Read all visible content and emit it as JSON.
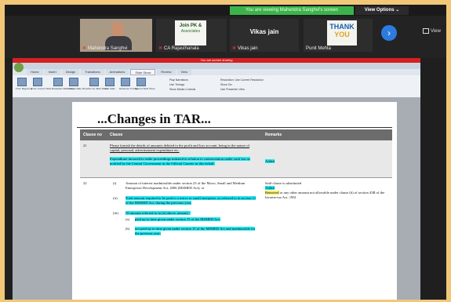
{
  "banner": {
    "text": "You are viewing Mahendra Sanghvi's screen"
  },
  "view_options": {
    "label": "View Options",
    "chevron": "chevron-down-icon"
  },
  "participants": [
    {
      "name": "Mahendra Sanghvi"
    },
    {
      "name": "CA Rajasthanala"
    },
    {
      "name": "Vikas jain",
      "display": "Vikas jain"
    },
    {
      "name": "Punit Mehta"
    }
  ],
  "logo": {
    "line1": "Join PK &",
    "line2": "Associates"
  },
  "thank_you": {
    "line1": "THANK",
    "line2": "YOU"
  },
  "view_label": "View",
  "app": {
    "redbar": "You are screen sharing",
    "tabs": [
      "Home",
      "Insert",
      "Design",
      "Transitions",
      "Animations",
      "Slide Show",
      "Review",
      "View"
    ],
    "ribbon": {
      "buttons": [
        "From Beginning",
        "From Current Slide",
        "Broadcast Slide Show",
        "Custom Slide Show",
        "Set Up Slide Show",
        "Hide Slide",
        "Rehearse Timings",
        "Record Slide Show"
      ],
      "options": [
        "Play Narrations",
        "Use Timings",
        "Show Media Controls"
      ],
      "monitor": [
        "Resolution: Use Current Resolution",
        "Show On:",
        "Use Presenter View"
      ]
    }
  },
  "slide": {
    "title": "...Changes in TAR...",
    "columns": [
      "Clause no",
      "Clause",
      "Remarks"
    ],
    "rows": [
      {
        "no": "21",
        "clause_plain": "Please furnish the details of amounts debited to the profit and loss account, being in the nature of capital, personal, advertisement expenditure etc.",
        "clause_added": "Expenditure incurred to settle proceedings initiated in relation to contravention under such law as notified by the Central Government in the Official Gazette in this behalf.",
        "remark": "Added"
      },
      {
        "no": "22",
        "items": [
          {
            "label": "(i)",
            "text": "Amount of interest inadmissible under section 23 of the Micro, Small and Medium Enterprises Development Act, 2006 (MSMED Act); or"
          },
          {
            "label": "(ii)",
            "text": "Total amount required to be paid to a micro or small enterprise, as referred to in section 15 of the MSMED Act, during the previous year;"
          },
          {
            "label": "(iii)",
            "text": "Of amount referred to in (ii) above, amount -"
          },
          {
            "label": "(a)",
            "text": "paid up to time given under section 15 of the MSMED Act;"
          },
          {
            "label": "(b)",
            "text": "not paid up to time given under section 15 of the MSMED Act and inadmissible for the previous year;"
          }
        ],
        "remark_line1": "Said clause is substituted",
        "remark_added": "Added",
        "remark_removed": "Removed",
        "remark_rest": "or any other amount not allowable under clause (h) of section 43B of the Income-tax Act, 1961"
      }
    ]
  }
}
